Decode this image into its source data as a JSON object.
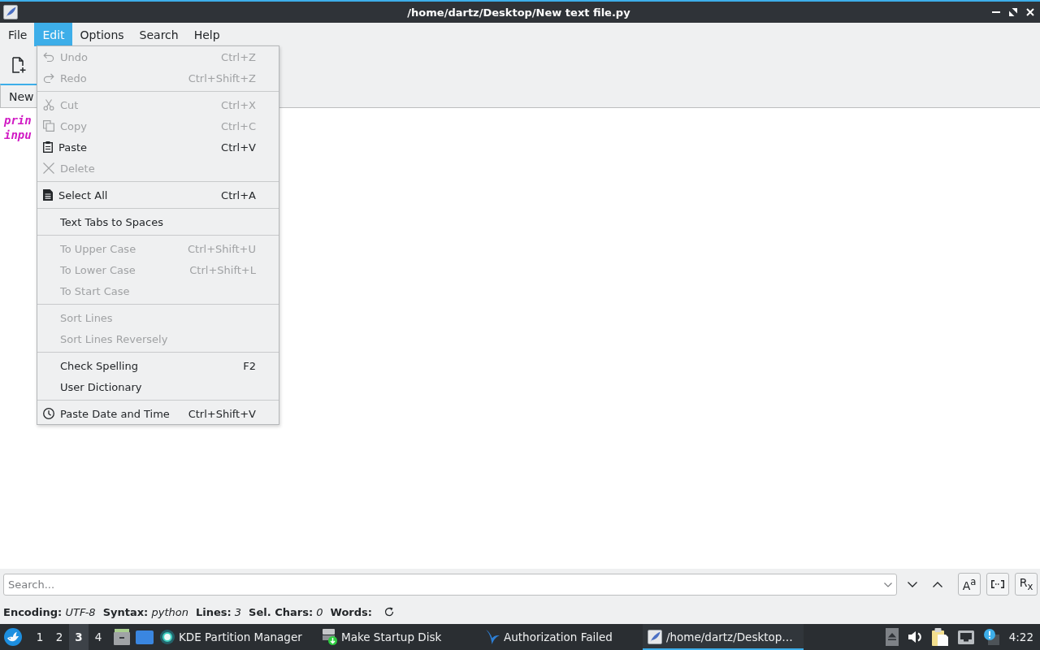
{
  "window": {
    "title": "/home/dartz/Desktop/New text file.py"
  },
  "menu_bar": [
    {
      "label": "File",
      "selected": false
    },
    {
      "label": "Edit",
      "selected": true
    },
    {
      "label": "Options",
      "selected": false
    },
    {
      "label": "Search",
      "selected": false
    },
    {
      "label": "Help",
      "selected": false
    }
  ],
  "tabs": [
    {
      "label": "New",
      "selected": true
    }
  ],
  "editor": {
    "lines": [
      "prin",
      "inpu"
    ]
  },
  "edit_menu": {
    "groups": [
      {
        "items": [
          {
            "label": "Undo",
            "shortcut": "Ctrl+Z",
            "disabled": true
          },
          {
            "label": "Redo",
            "shortcut": "Ctrl+Shift+Z",
            "disabled": true
          }
        ]
      },
      {
        "items": [
          {
            "label": "Cut",
            "shortcut": "Ctrl+X",
            "disabled": true
          },
          {
            "label": "Copy",
            "shortcut": "Ctrl+C",
            "disabled": true
          },
          {
            "label": "Paste",
            "shortcut": "Ctrl+V",
            "disabled": false
          },
          {
            "label": "Delete",
            "disabled": true
          }
        ]
      },
      {
        "items": [
          {
            "label": "Select All",
            "shortcut": "Ctrl+A",
            "disabled": false
          }
        ]
      },
      {
        "items": [
          {
            "label": "Text Tabs to Spaces",
            "disabled": false
          }
        ]
      },
      {
        "items": [
          {
            "label": "To Upper Case",
            "shortcut": "Ctrl+Shift+U",
            "disabled": true
          },
          {
            "label": "To Lower Case",
            "shortcut": "Ctrl+Shift+L",
            "disabled": true
          },
          {
            "label": "To Start Case",
            "disabled": true
          }
        ]
      },
      {
        "items": [
          {
            "label": "Sort Lines",
            "disabled": true
          },
          {
            "label": "Sort Lines Reversely",
            "disabled": true
          }
        ]
      },
      {
        "items": [
          {
            "label": "Check Spelling",
            "shortcut": "F2",
            "disabled": false
          },
          {
            "label": "User Dictionary",
            "disabled": false
          }
        ]
      },
      {
        "items": [
          {
            "label": "Paste Date and Time",
            "shortcut": "Ctrl+Shift+V",
            "disabled": false
          }
        ]
      }
    ]
  },
  "search_bar": {
    "placeholder": "Search...",
    "match_case": "A$^{a}$",
    "regex": "R$_{x}$"
  },
  "status_bar": {
    "items": [
      {
        "label": "Encoding:",
        "value": "UTF-8"
      },
      {
        "label": "Syntax:",
        "value": "python"
      },
      {
        "label": "Lines:",
        "value": "3"
      },
      {
        "label": "Sel. Chars:",
        "value": "0"
      },
      {
        "label": "Words:"
      }
    ]
  },
  "taskbar": {
    "desktops": [
      {
        "label": "1",
        "selected": false
      },
      {
        "label": "2",
        "selected": false
      },
      {
        "label": "3",
        "selected": true
      },
      {
        "label": "4",
        "selected": false
      }
    ],
    "tasks": [
      {
        "label": "KDE Partition Manager",
        "selected": false
      },
      {
        "label": "Make Startup Disk",
        "selected": false
      },
      {
        "label": "Authorization Failed",
        "selected": false
      },
      {
        "label": "/home/dartz/Desktop…",
        "selected": true
      }
    ],
    "clock": "4:22"
  }
}
